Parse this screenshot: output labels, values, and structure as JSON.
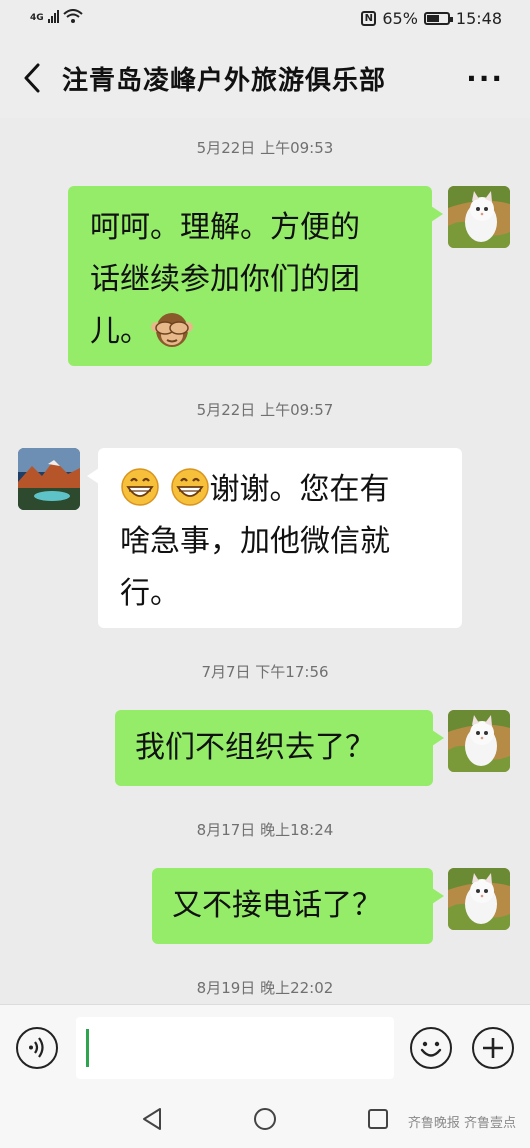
{
  "status_bar": {
    "network": "4G",
    "battery_percent": "65%",
    "battery_level": 0.65,
    "time": "15:48"
  },
  "header": {
    "title": "注青岛凌峰户外旅游俱乐部",
    "more_label": "···"
  },
  "messages": [
    {
      "type": "timestamp",
      "text": "5月22日 上午09:53"
    },
    {
      "type": "message",
      "from": "me",
      "lines": [
        "呵呵。理解。方便的",
        "话继续参加你们的团",
        "儿。"
      ],
      "trailing_emoji": "see-no-evil-monkey"
    },
    {
      "type": "timestamp",
      "text": "5月22日 上午09:57"
    },
    {
      "type": "message",
      "from": "other",
      "leading_emoji": [
        "grin-emoji",
        "grin-emoji"
      ],
      "lines": [
        "谢谢。您在有",
        "啥急事，加他微信就",
        "行。"
      ]
    },
    {
      "type": "timestamp",
      "text": "7月7日 下午17:56"
    },
    {
      "type": "message",
      "from": "me",
      "lines": [
        "我们不组织去了？"
      ]
    },
    {
      "type": "timestamp",
      "text": "8月17日 晚上18:24"
    },
    {
      "type": "message",
      "from": "me",
      "lines": [
        "又不接电话了？"
      ]
    },
    {
      "type": "timestamp",
      "text": "8月19日 晚上22:02"
    }
  ],
  "input_bar": {
    "voice_icon": "voice-icon",
    "emoji_icon": "emoji-icon",
    "plus_icon": "plus-icon",
    "value": ""
  },
  "watermark": "齐鲁晚报 齐鲁壹点",
  "colors": {
    "my_bubble": "#95ec69",
    "other_bubble": "#ffffff",
    "background": "#ebebeb"
  }
}
